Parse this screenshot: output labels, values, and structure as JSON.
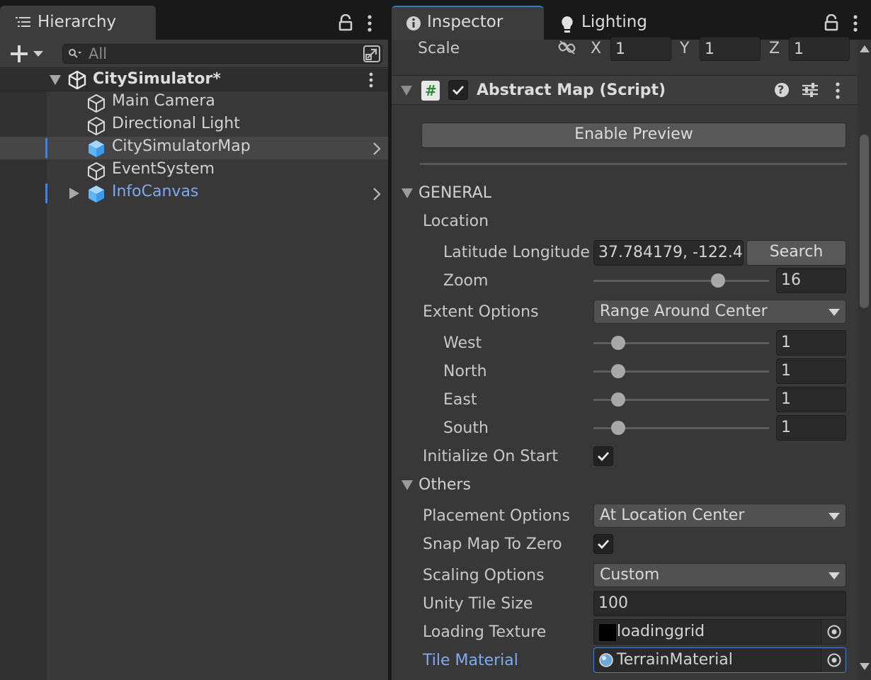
{
  "hierarchy": {
    "tab_label": "Hierarchy",
    "search_placeholder": "All",
    "scene_name": "CitySimulator*",
    "items": [
      {
        "label": "Main Camera"
      },
      {
        "label": "Directional Light"
      },
      {
        "label": "CitySimulatorMap"
      },
      {
        "label": "EventSystem"
      },
      {
        "label": "InfoCanvas"
      }
    ]
  },
  "inspector": {
    "tabs": [
      {
        "label": "Inspector"
      },
      {
        "label": "Lighting"
      }
    ],
    "scale": {
      "label": "Scale",
      "x_label": "X",
      "x": "1",
      "y_label": "Y",
      "y": "1",
      "z_label": "Z",
      "z": "1"
    },
    "component": {
      "title": "Abstract Map (Script)",
      "script_glyph": "#",
      "help_glyph": "?",
      "enabled": true
    },
    "enable_preview_label": "Enable Preview",
    "general": {
      "header": "GENERAL",
      "location_label": "Location",
      "lat_lon_label": "Latitude Longitude",
      "lat_lon_value": "37.784179, -122.4",
      "search_label": "Search",
      "zoom_label": "Zoom",
      "zoom_value": "16",
      "zoom_slider_fraction": 0.71,
      "extent_label": "Extent Options",
      "extent_value": "Range Around Center",
      "directions": [
        {
          "label": "West",
          "value": "1",
          "fraction": 0.14
        },
        {
          "label": "North",
          "value": "1",
          "fraction": 0.14
        },
        {
          "label": "East",
          "value": "1",
          "fraction": 0.14
        },
        {
          "label": "South",
          "value": "1",
          "fraction": 0.14
        }
      ],
      "initialize_label": "Initialize On Start",
      "initialize_checked": true
    },
    "others": {
      "header": "Others",
      "placement_label": "Placement Options",
      "placement_value": "At Location Center",
      "snap_label": "Snap Map To Zero",
      "snap_checked": true,
      "scaling_label": "Scaling Options",
      "scaling_value": "Custom",
      "tile_size_label": "Unity Tile Size",
      "tile_size_value": "100",
      "loading_texture_label": "Loading Texture",
      "loading_texture_value": "loadinggrid",
      "tile_material_label": "Tile Material",
      "tile_material_value": "TerrainMaterial"
    }
  },
  "colors": {
    "accent": "#3a79bb",
    "prefab_text": "#80a9ef",
    "panel_bg": "#383838",
    "selection_bar": "#4c7fcf"
  },
  "icons": [
    "hierarchy-list-icon",
    "lock-icon",
    "kebab-menu-icon",
    "plus-icon",
    "search-icon",
    "expand-window-icon",
    "unity-scene-icon",
    "gameobject-cube-icon",
    "prefab-cube-icon",
    "chevron-right-icon",
    "info-icon",
    "lightbulb-icon",
    "unlink-icon",
    "script-icon",
    "help-icon",
    "preset-sliders-icon",
    "object-picker-icon",
    "dropdown-arrow-icon",
    "checkmark-icon",
    "foldout-arrow-icon"
  ]
}
